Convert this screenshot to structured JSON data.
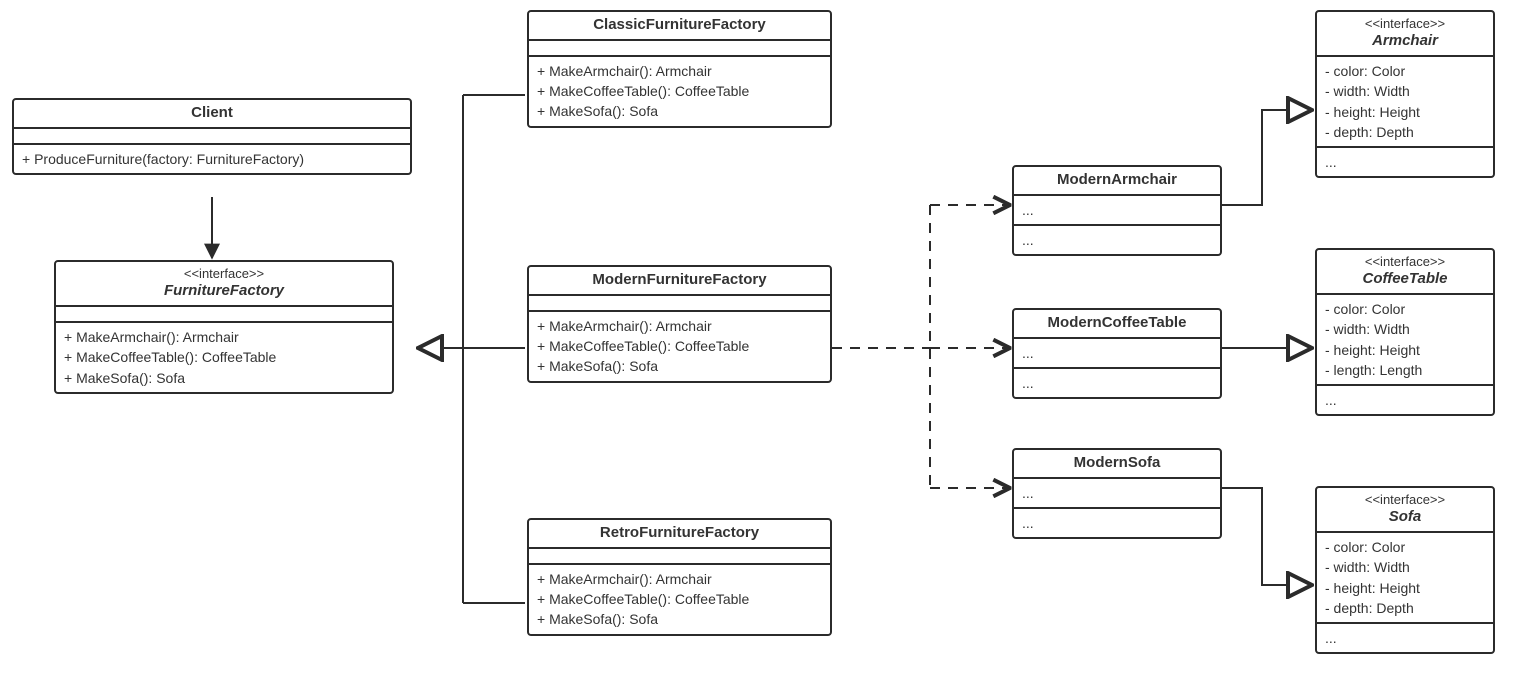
{
  "client": {
    "title": "Client",
    "op1": "+ ProduceFurniture(factory: FurnitureFactory)"
  },
  "furnitureFactory": {
    "stereo": "<<interface>>",
    "title": "FurnitureFactory",
    "op1": "+ MakeArmchair(): Armchair",
    "op2": "+ MakeCoffeeTable(): CoffeeTable",
    "op3": "+ MakeSofa(): Sofa"
  },
  "classicFactory": {
    "title": "ClassicFurnitureFactory",
    "op1": "+ MakeArmchair(): Armchair",
    "op2": "+ MakeCoffeeTable(): CoffeeTable",
    "op3": "+ MakeSofa(): Sofa"
  },
  "modernFactory": {
    "title": "ModernFurnitureFactory",
    "op1": "+ MakeArmchair(): Armchair",
    "op2": "+ MakeCoffeeTable(): CoffeeTable",
    "op3": "+ MakeSofa(): Sofa"
  },
  "retroFactory": {
    "title": "RetroFurnitureFactory",
    "op1": "+ MakeArmchair(): Armchair",
    "op2": "+ MakeCoffeeTable(): CoffeeTable",
    "op3": "+ MakeSofa(): Sofa"
  },
  "modernArmchair": {
    "title": "ModernArmchair",
    "attrs": "...",
    "ops": "..."
  },
  "modernCoffeeTable": {
    "title": "ModernCoffeeTable",
    "attrs": "...",
    "ops": "..."
  },
  "modernSofa": {
    "title": "ModernSofa",
    "attrs": "...",
    "ops": "..."
  },
  "armchairIf": {
    "stereo": "<<interface>>",
    "title": "Armchair",
    "a1": "- color: Color",
    "a2": "- width: Width",
    "a3": "- height: Height",
    "a4": "- depth: Depth",
    "ops": "..."
  },
  "coffeeTableIf": {
    "stereo": "<<interface>>",
    "title": "CoffeeTable",
    "a1": "- color: Color",
    "a2": "- width: Width",
    "a3": "- height: Height",
    "a4": "- length: Length",
    "ops": "..."
  },
  "sofaIf": {
    "stereo": "<<interface>>",
    "title": "Sofa",
    "a1": "- color: Color",
    "a2": "- width: Width",
    "a3": "- height: Height",
    "a4": "- depth: Depth",
    "ops": "..."
  },
  "chart_data": {
    "type": "uml-class-diagram",
    "classes": [
      {
        "name": "Client",
        "compartments": [
          [],
          [
            "+ ProduceFurniture(factory: FurnitureFactory)"
          ]
        ]
      },
      {
        "name": "FurnitureFactory",
        "stereotype": "interface",
        "compartments": [
          [],
          [
            "+ MakeArmchair(): Armchair",
            "+ MakeCoffeeTable(): CoffeeTable",
            "+ MakeSofa(): Sofa"
          ]
        ]
      },
      {
        "name": "ClassicFurnitureFactory",
        "compartments": [
          [],
          [
            "+ MakeArmchair(): Armchair",
            "+ MakeCoffeeTable(): CoffeeTable",
            "+ MakeSofa(): Sofa"
          ]
        ]
      },
      {
        "name": "ModernFurnitureFactory",
        "compartments": [
          [],
          [
            "+ MakeArmchair(): Armchair",
            "+ MakeCoffeeTable(): CoffeeTable",
            "+ MakeSofa(): Sofa"
          ]
        ]
      },
      {
        "name": "RetroFurnitureFactory",
        "compartments": [
          [],
          [
            "+ MakeArmchair(): Armchair",
            "+ MakeCoffeeTable(): CoffeeTable",
            "+ MakeSofa(): Sofa"
          ]
        ]
      },
      {
        "name": "ModernArmchair",
        "compartments": [
          [
            "..."
          ],
          [
            "..."
          ]
        ]
      },
      {
        "name": "ModernCoffeeTable",
        "compartments": [
          [
            "..."
          ],
          [
            "..."
          ]
        ]
      },
      {
        "name": "ModernSofa",
        "compartments": [
          [
            "..."
          ],
          [
            "..."
          ]
        ]
      },
      {
        "name": "Armchair",
        "stereotype": "interface",
        "compartments": [
          [
            "- color: Color",
            "- width: Width",
            "- height: Height",
            "- depth: Depth"
          ],
          [
            "..."
          ]
        ]
      },
      {
        "name": "CoffeeTable",
        "stereotype": "interface",
        "compartments": [
          [
            "- color: Color",
            "- width: Width",
            "- height: Height",
            "- length: Length"
          ],
          [
            "..."
          ]
        ]
      },
      {
        "name": "Sofa",
        "stereotype": "interface",
        "compartments": [
          [
            "- color: Color",
            "- width: Width",
            "- height: Height",
            "- depth: Depth"
          ],
          [
            "..."
          ]
        ]
      }
    ],
    "relations": [
      {
        "from": "Client",
        "to": "FurnitureFactory",
        "type": "association-arrow"
      },
      {
        "from": "ClassicFurnitureFactory",
        "to": "FurnitureFactory",
        "type": "realization"
      },
      {
        "from": "ModernFurnitureFactory",
        "to": "FurnitureFactory",
        "type": "realization"
      },
      {
        "from": "RetroFurnitureFactory",
        "to": "FurnitureFactory",
        "type": "realization"
      },
      {
        "from": "ModernFurnitureFactory",
        "to": "ModernArmchair",
        "type": "dependency"
      },
      {
        "from": "ModernFurnitureFactory",
        "to": "ModernCoffeeTable",
        "type": "dependency"
      },
      {
        "from": "ModernFurnitureFactory",
        "to": "ModernSofa",
        "type": "dependency"
      },
      {
        "from": "ModernArmchair",
        "to": "Armchair",
        "type": "realization"
      },
      {
        "from": "ModernCoffeeTable",
        "to": "CoffeeTable",
        "type": "realization"
      },
      {
        "from": "ModernSofa",
        "to": "Sofa",
        "type": "realization"
      }
    ]
  }
}
